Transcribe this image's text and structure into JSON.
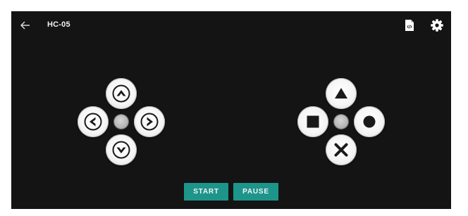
{
  "app": {
    "title": "HC-05",
    "icons": {
      "back": "back-arrow-icon",
      "code": "code-file-icon",
      "settings": "gear-icon"
    }
  },
  "dpad": {
    "up": "chevron-up-icon",
    "left": "chevron-left-icon",
    "right": "chevron-right-icon",
    "down": "chevron-down-icon"
  },
  "face_buttons": {
    "top": "triangle-icon",
    "left": "square-icon",
    "right": "circle-icon",
    "bottom": "cross-icon"
  },
  "controls": {
    "start_label": "START",
    "pause_label": "PAUSE"
  },
  "colors": {
    "background": "#141414",
    "accent": "#1e958a",
    "button_face": "#f5f5f5",
    "glyph": "#1a1a1a"
  }
}
